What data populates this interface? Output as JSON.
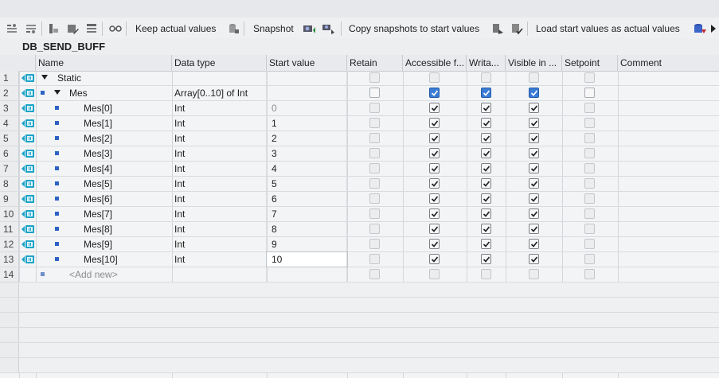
{
  "toolbar": {
    "keep_actual": "Keep actual values",
    "snapshot": "Snapshot",
    "copy_snapshots": "Copy snapshots to start values",
    "load_start": "Load start values as actual values"
  },
  "db_name": "DB_SEND_BUFF",
  "columns": {
    "name": "Name",
    "data_type": "Data type",
    "start_value": "Start value",
    "retain": "Retain",
    "accessible": "Accessible f...",
    "writable": "Writa...",
    "visible": "Visible in ...",
    "setpoint": "Setpoint",
    "comment": "Comment"
  },
  "rows": [
    {
      "num": "1",
      "name": "Static",
      "type": "",
      "start": ""
    },
    {
      "num": "2",
      "name": "Mes",
      "type": "Array[0..10] of Int",
      "start": ""
    },
    {
      "num": "3",
      "name": "Mes[0]",
      "type": "Int",
      "start": "0"
    },
    {
      "num": "4",
      "name": "Mes[1]",
      "type": "Int",
      "start": "1"
    },
    {
      "num": "5",
      "name": "Mes[2]",
      "type": "Int",
      "start": "2"
    },
    {
      "num": "6",
      "name": "Mes[3]",
      "type": "Int",
      "start": "3"
    },
    {
      "num": "7",
      "name": "Mes[4]",
      "type": "Int",
      "start": "4"
    },
    {
      "num": "8",
      "name": "Mes[5]",
      "type": "Int",
      "start": "5"
    },
    {
      "num": "9",
      "name": "Mes[6]",
      "type": "Int",
      "start": "6"
    },
    {
      "num": "10",
      "name": "Mes[7]",
      "type": "Int",
      "start": "7"
    },
    {
      "num": "11",
      "name": "Mes[8]",
      "type": "Int",
      "start": "8"
    },
    {
      "num": "12",
      "name": "Mes[9]",
      "type": "Int",
      "start": "9"
    },
    {
      "num": "13",
      "name": "Mes[10]",
      "type": "Int",
      "start": "10"
    },
    {
      "num": "14",
      "name": "<Add new>",
      "type": "",
      "start": ""
    }
  ],
  "colors": {
    "accent": "#3a7bd5",
    "member_dot": "#2c62c4",
    "interface_icon": "#1aa3c7"
  },
  "icons": [
    "snapshot-icon",
    "copy-snapshot-icon",
    "load-values-icon",
    "interface-icon",
    "member-dot-icon"
  ]
}
